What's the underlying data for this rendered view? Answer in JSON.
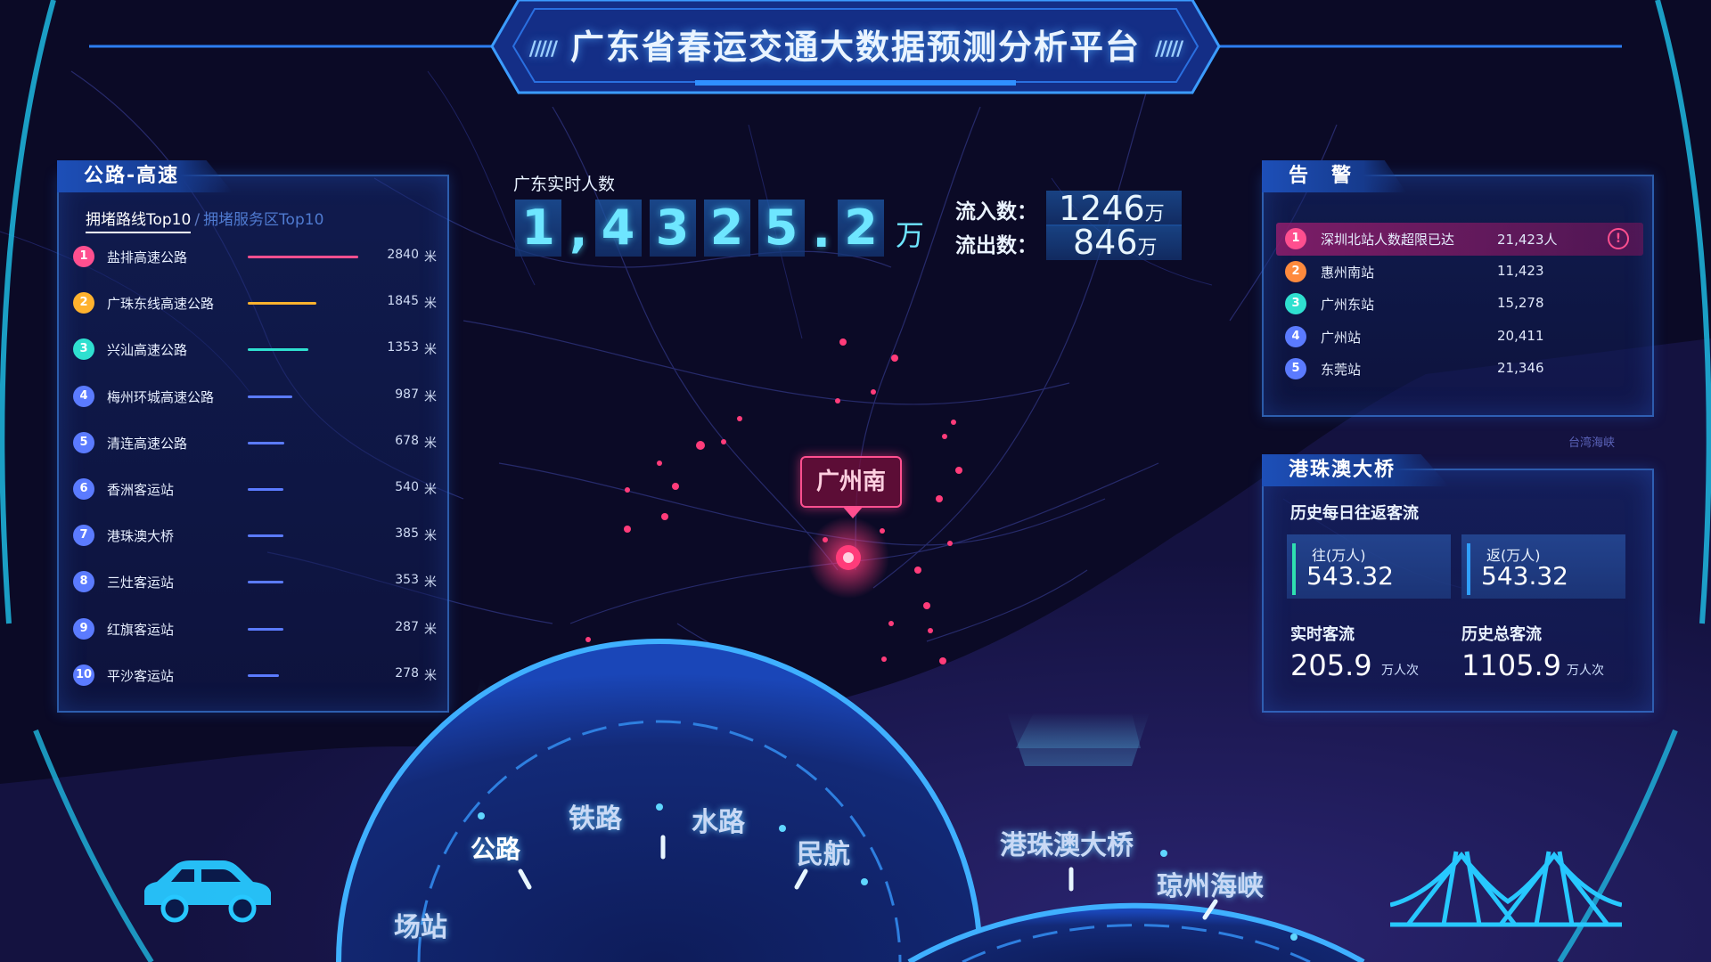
{
  "header": {
    "title": "广东省春运交通大数据预测分析平台",
    "deco_left": "/////",
    "deco_right": "/////"
  },
  "left_panel": {
    "title": "公路-高速",
    "tab_active": "拥堵路线Top10",
    "tab_separator": "/",
    "tab_inactive": "拥堵服务区Top10",
    "items": [
      {
        "rank": "1",
        "name": "盐排高速公路",
        "value": "2840",
        "unit": "米",
        "bar_fraction": 1.0,
        "color": "#ff4f8f"
      },
      {
        "rank": "2",
        "name": "广珠东线高速公路",
        "value": "1845",
        "unit": "米",
        "bar_fraction": 0.62,
        "color": "#ffb22e"
      },
      {
        "rank": "3",
        "name": "兴汕高速公路",
        "value": "1353",
        "unit": "米",
        "bar_fraction": 0.55,
        "color": "#2fe0d0"
      },
      {
        "rank": "4",
        "name": "梅州环城高速公路",
        "value": "987",
        "unit": "米",
        "bar_fraction": 0.4,
        "color": "#5b7bff"
      },
      {
        "rank": "5",
        "name": "清连高速公路",
        "value": "678",
        "unit": "米",
        "bar_fraction": 0.33,
        "color": "#5b7bff"
      },
      {
        "rank": "6",
        "name": "香洲客运站",
        "value": "540",
        "unit": "米",
        "bar_fraction": 0.32,
        "color": "#5b7bff"
      },
      {
        "rank": "7",
        "name": "港珠澳大桥",
        "value": "385",
        "unit": "米",
        "bar_fraction": 0.32,
        "color": "#5b7bff"
      },
      {
        "rank": "8",
        "name": "三灶客运站",
        "value": "353",
        "unit": "米",
        "bar_fraction": 0.32,
        "color": "#5b7bff"
      },
      {
        "rank": "9",
        "name": "红旗客运站",
        "value": "287",
        "unit": "米",
        "bar_fraction": 0.32,
        "color": "#5b7bff"
      },
      {
        "rank": "10",
        "name": "平沙客运站",
        "value": "278",
        "unit": "米",
        "bar_fraction": 0.28,
        "color": "#5b7bff"
      }
    ]
  },
  "realtime": {
    "label": "广东实时人数",
    "digits": [
      "1",
      ",",
      "4",
      "3",
      "2",
      "5",
      ".",
      "2"
    ],
    "unit": "万",
    "inflow_label": "流入数：",
    "inflow_value": "1246",
    "outflow_label": "流出数：",
    "outflow_value": "846",
    "flow_unit": "万"
  },
  "map": {
    "marker_label": "广州南",
    "strait_label": "台湾海峡"
  },
  "alert_panel": {
    "title": "告　警",
    "items": [
      {
        "rank": "1",
        "name": "深圳北站人数超限已达",
        "value": "21,423人",
        "hot": true,
        "color": "#ff4f8f"
      },
      {
        "rank": "2",
        "name": "惠州南站",
        "value": "11,423",
        "hot": false,
        "color": "#ff8a3d"
      },
      {
        "rank": "3",
        "name": "广州东站",
        "value": "15,278",
        "hot": false,
        "color": "#2fe0d0"
      },
      {
        "rank": "4",
        "name": "广州站",
        "value": "20,411",
        "hot": false,
        "color": "#5b7bff"
      },
      {
        "rank": "5",
        "name": "东莞站",
        "value": "21,346",
        "hot": false,
        "color": "#5b7bff"
      }
    ],
    "alert_icon": "!"
  },
  "bridge_panel": {
    "title": "港珠澳大桥",
    "subtitle": "历史每日往返客流",
    "go_label": "往(万人)",
    "go_value": "543.32",
    "back_label": "返(万人)",
    "back_value": "543.32",
    "realtime_label": "实时客流",
    "realtime_value": "205.9",
    "realtime_unit": "万人次",
    "total_label": "历史总客流",
    "total_value": "1105.9",
    "total_unit": "万人次"
  },
  "dial_left": {
    "items": [
      "场站",
      "公路",
      "铁路",
      "水路",
      "民航"
    ],
    "active": "公路"
  },
  "dial_right": {
    "items": [
      "港珠澳大桥",
      "琼州海峡"
    ]
  },
  "icons": {
    "left_icon": "car-icon",
    "right_icon": "bridge-icon"
  },
  "colors": {
    "accent": "#6ee6ff",
    "alert": "#ff4f8f",
    "panel_border": "#4696ff"
  }
}
